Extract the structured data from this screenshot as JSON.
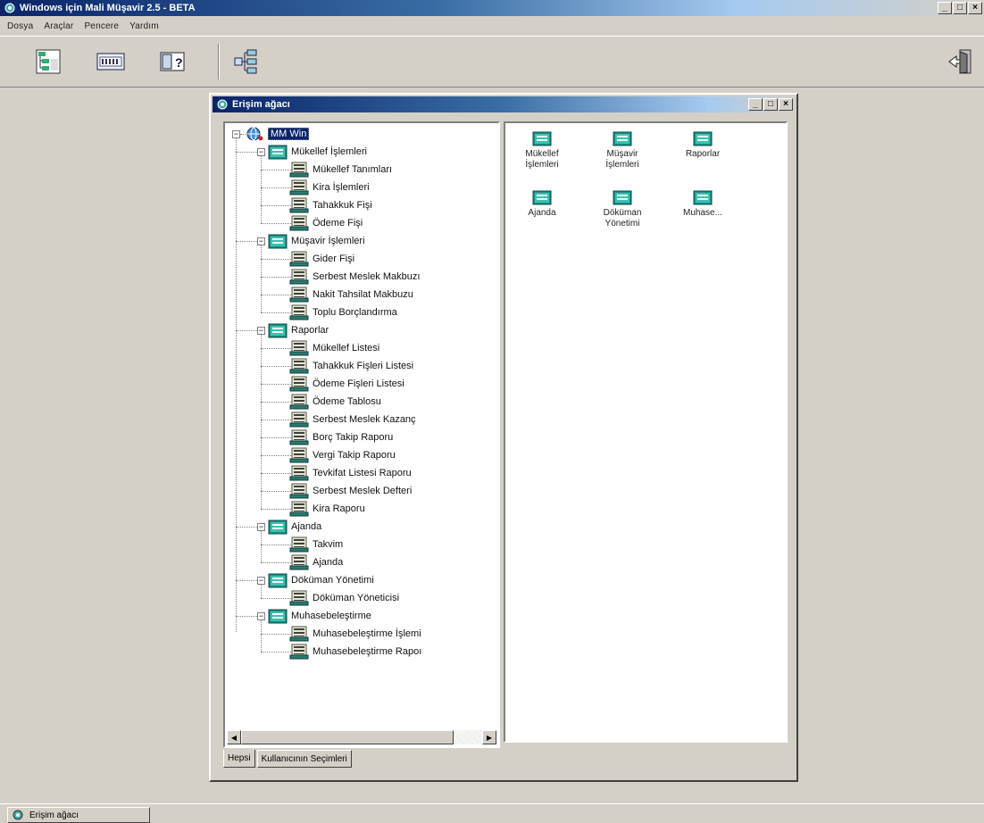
{
  "app": {
    "title": "Windows için Mali Müşavir 2.5 - BETA"
  },
  "window_buttons": {
    "minimize": "_",
    "maximize": "□",
    "close": "×"
  },
  "menu": [
    "Dosya",
    "Araçlar",
    "Pencere",
    "Yardım"
  ],
  "toolbar": {
    "icons": [
      "tree-view-icon",
      "calculator-icon",
      "help-book-icon",
      "network-icon",
      "exit-door-icon"
    ]
  },
  "child_window": {
    "title": "Erişim ağacı"
  },
  "tree": {
    "root": "MM Win",
    "groups": [
      {
        "label": "Mükellef İşlemleri",
        "items": [
          "Mükellef Tanımları",
          "Kira İşlemleri",
          "Tahakkuk Fişi",
          "Ödeme Fişi"
        ]
      },
      {
        "label": "Müşavir İşlemleri",
        "items": [
          "Gider Fişi",
          "Serbest Meslek Makbuzı",
          "Nakit Tahsilat Makbuzu",
          "Toplu Borçlandırma"
        ]
      },
      {
        "label": "Raporlar",
        "items": [
          "Mükellef Listesi",
          "Tahakkuk Fişleri Listesi",
          "Ödeme Fişleri Listesi",
          "Ödeme Tablosu",
          "Serbest Meslek Kazanç",
          "Borç Takip Raporu",
          "Vergi Takip Raporu",
          "Tevkifat Listesi Raporu",
          "Serbest Meslek Defteri",
          "Kira Raporu"
        ]
      },
      {
        "label": "Ajanda",
        "items": [
          "Takvim",
          "Ajanda"
        ]
      },
      {
        "label": "Döküman Yönetimi",
        "items": [
          "Döküman Yöneticisi"
        ]
      },
      {
        "label": "Muhasebeleştirme",
        "items": [
          "Muhasebeleştirme İşlemi",
          "Muhasebeleştirme Rapoı"
        ]
      }
    ]
  },
  "tabs": [
    "Hepsi",
    "Kullanıcının Seçimleri"
  ],
  "icon_pane": [
    {
      "line1": "Mükellef",
      "line2": "İşlemleri"
    },
    {
      "line1": "Müşavir",
      "line2": "İşlemleri"
    },
    {
      "line1": "Raporlar",
      "line2": ""
    },
    {
      "line1": "Ajanda",
      "line2": ""
    },
    {
      "line1": "Döküman",
      "line2": "Yönetimi"
    },
    {
      "line1": "Muhase...",
      "line2": ""
    }
  ],
  "status": {
    "task_label": "Erişim ağacı"
  },
  "colors": {
    "title_active": "#0a246a",
    "face": "#d4d0c8",
    "folder_teal": "#1a9a8a"
  }
}
